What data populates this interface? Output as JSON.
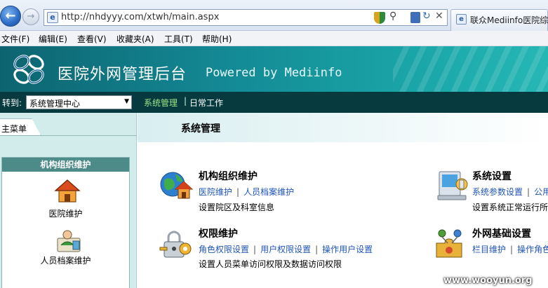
{
  "browser": {
    "url": "http://nhdyyy.com/xtwh/main.aspx",
    "tab_title": "联众Mediinfo医院综..."
  },
  "menubar": {
    "items": [
      "文件(F)",
      "编辑(E)",
      "查看(V)",
      "收藏夹(A)",
      "工具(T)",
      "帮助(H)"
    ]
  },
  "header": {
    "title": "医院外网管理后台",
    "powered": "Powered by Mediinfo"
  },
  "nav": {
    "goto_label": "转到:",
    "goto_value": "系统管理中心",
    "links": [
      "系统管理",
      "日常工作"
    ],
    "separator": "|"
  },
  "sidebar": {
    "tab_label": "主菜单",
    "panel_title": "机构组织维护",
    "items": [
      {
        "label": "医院维护",
        "icon": "house-icon"
      },
      {
        "label": "人员档案维护",
        "icon": "staff-record-icon"
      }
    ]
  },
  "main": {
    "title": "系统管理",
    "modules": [
      {
        "title": "机构组织维护",
        "links": [
          "医院维护",
          "人员档案维护"
        ],
        "desc": "设置院区及科室信息",
        "icon": "globe-house-icon"
      },
      {
        "title": "系统设置",
        "links": [
          "系统参数设置",
          "公用"
        ],
        "desc": "设置系统正常运行所",
        "icon": "computer-settings-icon"
      },
      {
        "title": "权限维护",
        "links": [
          "角色权限设置",
          "用户权限设置",
          "操作用户设置"
        ],
        "desc": "设置人员菜单访问权限及数据访问权限",
        "icon": "lock-key-icon"
      },
      {
        "title": "外网基础设置",
        "links": [
          "栏目维护",
          "操作角色"
        ],
        "desc": "",
        "icon": "puzzle-network-icon"
      }
    ]
  },
  "watermark": "www.wooyun.org",
  "colors": {
    "header_teal": "#138894",
    "nav_dark": "#073a3e",
    "sidebar_bg": "#d2eceb",
    "link_blue": "#1f55b6",
    "nav_active_green": "#9ee685"
  }
}
